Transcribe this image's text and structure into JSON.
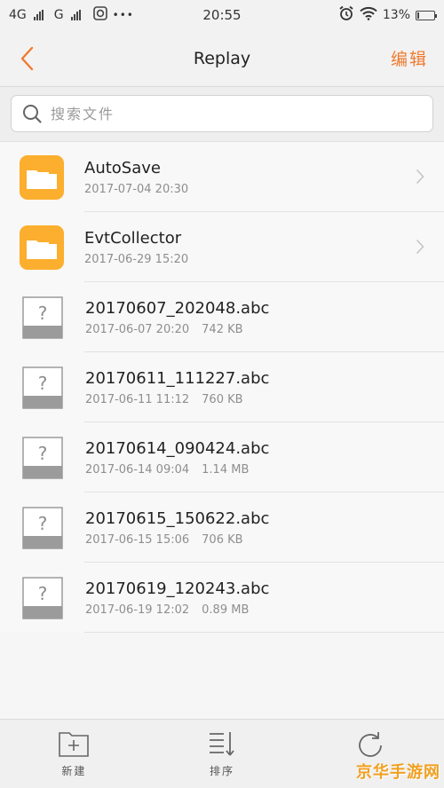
{
  "status_bar": {
    "network_1": "4G",
    "network_2": "G",
    "dots": "•••",
    "time": "20:55",
    "battery_percent": "13%",
    "battery_level": 0.13
  },
  "nav": {
    "title": "Replay",
    "edit_label": "编辑"
  },
  "search": {
    "placeholder": "搜索文件"
  },
  "files": [
    {
      "name": "AutoSave",
      "date": "2017-07-04 20:30",
      "size": "",
      "type": "folder"
    },
    {
      "name": "EvtCollector",
      "date": "2017-06-29 15:20",
      "size": "",
      "type": "folder"
    },
    {
      "name": "20170607_202048.abc",
      "date": "2017-06-07 20:20",
      "size": "742 KB",
      "type": "unknown"
    },
    {
      "name": "20170611_111227.abc",
      "date": "2017-06-11 11:12",
      "size": "760 KB",
      "type": "unknown"
    },
    {
      "name": "20170614_090424.abc",
      "date": "2017-06-14 09:04",
      "size": "1.14 MB",
      "type": "unknown"
    },
    {
      "name": "20170615_150622.abc",
      "date": "2017-06-15 15:06",
      "size": "706 KB",
      "type": "unknown"
    },
    {
      "name": "20170619_120243.abc",
      "date": "2017-06-19 12:02",
      "size": "0.89 MB",
      "type": "unknown"
    }
  ],
  "toolbar": {
    "new_label": "新建",
    "sort_label": "排序"
  },
  "watermark": "京华手游网",
  "colors": {
    "accent": "#ee7b2f",
    "folder": "#fcae2e"
  }
}
